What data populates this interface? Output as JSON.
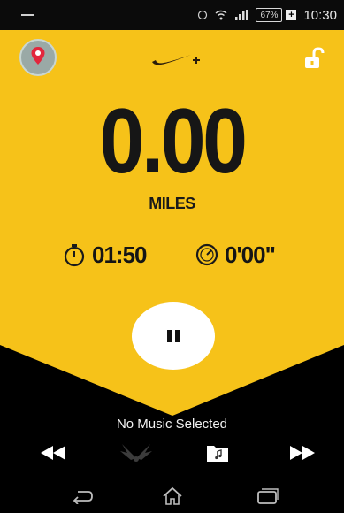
{
  "status_bar": {
    "battery": "67%",
    "time": "10:30"
  },
  "run": {
    "distance": "0.00",
    "unit": "MILES",
    "duration": "01:50",
    "pace": "0'00\""
  },
  "music": {
    "label": "No Music Selected"
  },
  "colors": {
    "accent": "#f6c219",
    "dark": "#000000"
  },
  "icons": {
    "map": "map-pin-icon",
    "logo": "nike-swoosh-plus",
    "lock": "unlock-icon",
    "stopwatch": "stopwatch-icon",
    "pace": "speedometer-icon",
    "pause": "pause-icon",
    "rewind": "rewind-icon",
    "powersong": "winged-icon",
    "playlist": "music-folder-icon",
    "fastforward": "fast-forward-icon",
    "back": "back-icon",
    "home": "home-icon",
    "recent": "recent-apps-icon"
  }
}
